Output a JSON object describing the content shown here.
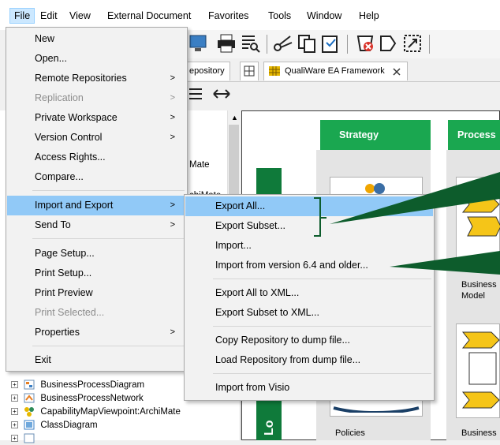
{
  "menubar": {
    "items": [
      "File",
      "Edit",
      "View",
      "External Document",
      "Favorites",
      "Tools",
      "Window",
      "Help"
    ]
  },
  "tabs": {
    "repository_partial": "epository",
    "framework": "QualiWare EA Framework"
  },
  "file_menu": {
    "items": [
      {
        "label": "New",
        "submenu": false,
        "disabled": false
      },
      {
        "label": "Open...",
        "submenu": false,
        "disabled": false
      },
      {
        "label": "Remote Repositories",
        "submenu": true,
        "disabled": false
      },
      {
        "label": "Replication",
        "submenu": true,
        "disabled": true
      },
      {
        "label": "Private Workspace",
        "submenu": true,
        "disabled": false
      },
      {
        "label": "Version Control",
        "submenu": true,
        "disabled": false
      },
      {
        "label": "Access Rights...",
        "submenu": false,
        "disabled": false
      },
      {
        "label": "Compare...",
        "submenu": false,
        "disabled": false
      },
      {
        "label": "Import and Export",
        "submenu": true,
        "disabled": false,
        "highlighted": true
      },
      {
        "label": "Send To",
        "submenu": true,
        "disabled": false
      },
      {
        "label": "Page Setup...",
        "submenu": false,
        "disabled": false
      },
      {
        "label": "Print Setup...",
        "submenu": false,
        "disabled": false
      },
      {
        "label": "Print Preview",
        "submenu": false,
        "disabled": false
      },
      {
        "label": "Print Selected...",
        "submenu": false,
        "disabled": true
      },
      {
        "label": "Properties",
        "submenu": true,
        "disabled": false
      },
      {
        "label": "Exit",
        "submenu": false,
        "disabled": false
      }
    ]
  },
  "import_export_menu": {
    "items": [
      {
        "label": "Export All...",
        "highlighted": true
      },
      {
        "label": "Export Subset..."
      },
      {
        "label": "Import..."
      },
      {
        "label": "Import from version 6.4 and older..."
      },
      {
        "label": "Export All to XML..."
      },
      {
        "label": "Export Subset to XML..."
      },
      {
        "label": "Copy Repository to dump file..."
      },
      {
        "label": "Load Repository from dump file..."
      },
      {
        "label": "Import from Visio"
      }
    ]
  },
  "tree": {
    "partial_1": "Mate",
    "partial_2": "chiMate",
    "items": [
      "BusinessProcessDiagram",
      "BusinessProcessNetwork",
      "CapabilityMapViewpoint:ArchiMate",
      "ClassDiagram"
    ]
  },
  "canvas": {
    "lanes": [
      "Strategy",
      "Process"
    ],
    "vertical_label": "Lo",
    "card_labels": [
      "Business",
      "Model",
      "Policies",
      "Business"
    ]
  },
  "colors": {
    "menu_highlight": "#91c9f7",
    "lane_green": "#1aa750",
    "vbar_green": "#0f7a3a",
    "callout_green": "#0d5c2c"
  }
}
